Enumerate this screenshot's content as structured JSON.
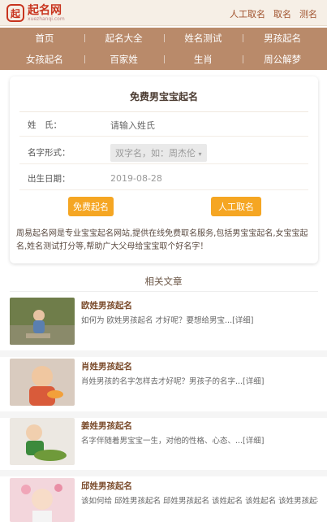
{
  "header": {
    "logo_glyph": "起",
    "logo_name": "起名网",
    "logo_sub": "xuezhanqi.com",
    "links": [
      "人工取名",
      "取名",
      "测名"
    ]
  },
  "nav": {
    "row1": [
      "首页",
      "起名大全",
      "姓名测试",
      "男孩起名"
    ],
    "row2": [
      "女孩起名",
      "百家姓",
      "生肖",
      "周公解梦"
    ]
  },
  "form": {
    "title": "免费男宝宝起名",
    "surname_label": "姓　氏：",
    "surname_placeholder": "请输入姓氏",
    "name_form_label": "名字形式：",
    "name_form_value": "双字名，如：周杰伦",
    "birth_label": "出生日期：",
    "birth_value": "2019-08-28",
    "free_button": "免费起名",
    "manual_button": "人工取名",
    "description": "周易起名网是专业宝宝起名网站,提供在线免费取名服务,包括男宝宝起名,女宝宝起名,姓名测试打分等,帮助广大父母给宝宝取个好名字！"
  },
  "related": {
    "title": "相关文章",
    "articles": [
      {
        "title": "欧姓男孩起名",
        "summary": "如何为 欧姓男孩起名 才好呢？要想给男宝...[详细]"
      },
      {
        "title": "肖姓男孩起名",
        "summary": "肖姓男孩的名字怎样去才好呢？男孩子的名字...[详细]"
      },
      {
        "title": "姜姓男孩起名",
        "summary": "名字伴随着男宝宝一生，对他的性格、心态、...[详细]"
      },
      {
        "title": "邱姓男孩起名",
        "summary": "该如何给 邱姓男孩起名 邱姓男孩起名 该姓起名 该姓起名 该姓男孩起名 邱"
      }
    ]
  },
  "colors": {
    "nav_bg": "#b98a6a",
    "button": "#f5a623",
    "logo": "#c8341e"
  }
}
